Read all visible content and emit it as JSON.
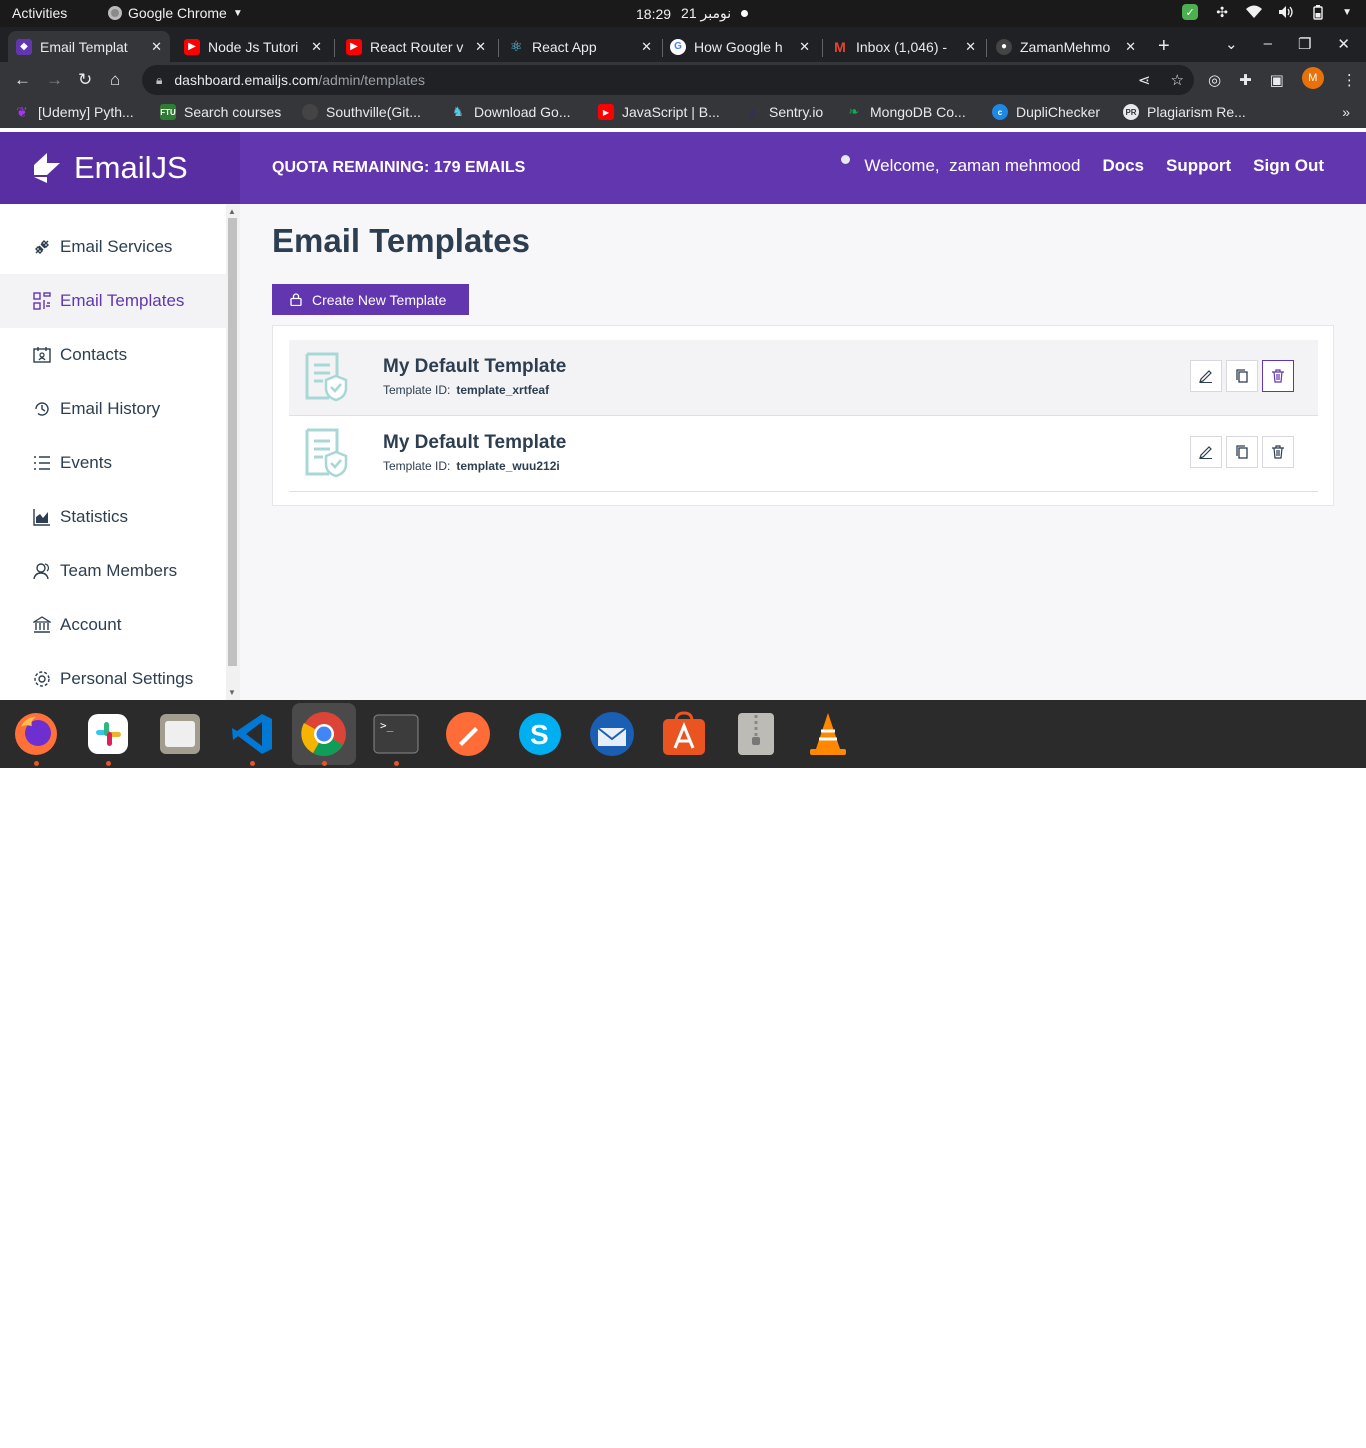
{
  "system_bar": {
    "activities": "Activities",
    "app_name": "Google Chrome",
    "time": "18:29",
    "date": "21 نومبر"
  },
  "browser": {
    "tabs": [
      {
        "title": "Email Templat",
        "active": true
      },
      {
        "title": "Node Js Tutori"
      },
      {
        "title": "React Router v"
      },
      {
        "title": "React App"
      },
      {
        "title": "How Google h"
      },
      {
        "title": "Inbox (1,046) -"
      },
      {
        "title": "ZamanMehmo"
      }
    ],
    "url_host": "dashboard.emailjs.com",
    "url_path": "/admin/templates",
    "profile_initial": "M",
    "bookmarks": [
      "[Udemy] Pyth...",
      "Search courses",
      "Southville(Git...",
      "Download Go...",
      "JavaScript | B...",
      "Sentry.io",
      "MongoDB Co...",
      "DupliChecker",
      "Plagiarism Re..."
    ],
    "bookmark_fav_text": {
      "search": "FTU",
      "plag": "PR"
    }
  },
  "header": {
    "brand": "EmailJS",
    "quota": "QUOTA REMAINING: 179 EMAILS",
    "welcome": "Welcome,",
    "user": "zaman mehmood",
    "docs": "Docs",
    "support": "Support",
    "sign_out": "Sign Out"
  },
  "sidebar": {
    "items": [
      {
        "label": "Email Services",
        "icon": "plug-icon"
      },
      {
        "label": "Email Templates",
        "icon": "templates-icon",
        "active": true
      },
      {
        "label": "Contacts",
        "icon": "contacts-icon"
      },
      {
        "label": "Email History",
        "icon": "history-icon"
      },
      {
        "label": "Events",
        "icon": "list-icon"
      },
      {
        "label": "Statistics",
        "icon": "chart-icon"
      },
      {
        "label": "Team Members",
        "icon": "team-icon"
      },
      {
        "label": "Account",
        "icon": "bank-icon"
      },
      {
        "label": "Personal Settings",
        "icon": "gear-icon"
      }
    ]
  },
  "main": {
    "title": "Email Templates",
    "create_button": "Create New Template",
    "id_label": "Template ID:",
    "templates": [
      {
        "name": "My Default Template",
        "id": "template_xrtfeaf"
      },
      {
        "name": "My Default Template",
        "id": "template_wuu212i"
      }
    ]
  },
  "colors": {
    "accent": "#6236af",
    "text": "#2c3e50"
  }
}
